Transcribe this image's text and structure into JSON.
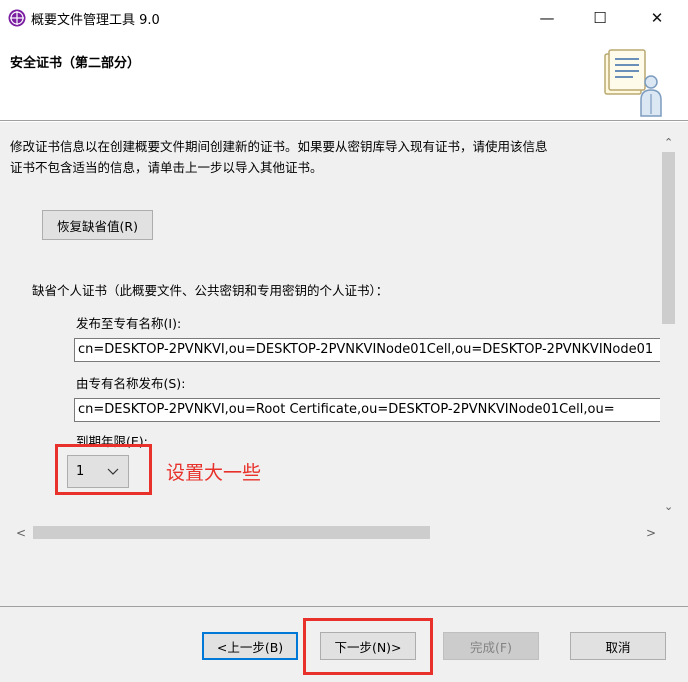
{
  "window": {
    "title": "概要文件管理工具 9.0",
    "minimize_label": "—",
    "maximize_label": "☐",
    "close_label": "✕"
  },
  "header": {
    "title": "安全证书（第二部分）"
  },
  "content": {
    "description_line1": "修改证书信息以在创建概要文件期间创建新的证书。如果要从密钥库导入现有证书，请使用该信息",
    "description_line2": "证书不包含适当的信息，请单击上一步以导入其他证书。",
    "restore_defaults_label": "恢复缺省值(R)",
    "default_cert_label": "缺省个人证书（此概要文件、公共密钥和专用密钥的个人证书）：",
    "issued_to_label": "发布至专有名称(I):",
    "issued_to_value": "cn=DESKTOP-2PVNKVI,ou=DESKTOP-2PVNKVINode01Cell,ou=DESKTOP-2PVNKVINode01",
    "issued_by_label": "由专有名称发布(S):",
    "issued_by_value": "cn=DESKTOP-2PVNKVI,ou=Root Certificate,ou=DESKTOP-2PVNKVINode01Cell,ou=",
    "expiry_label": "到期年限(E):",
    "expiry_value": "1",
    "annotation": "设置大一些"
  },
  "scroll": {
    "up": "⌃",
    "down": "⌄",
    "left": "<",
    "right": ">"
  },
  "footer": {
    "back_label": "<上一步(B)",
    "next_label": "下一步(N)>",
    "finish_label": "完成(F)",
    "cancel_label": "取消"
  },
  "colors": {
    "highlight": "#e8312b",
    "accent": "#0078d7"
  }
}
